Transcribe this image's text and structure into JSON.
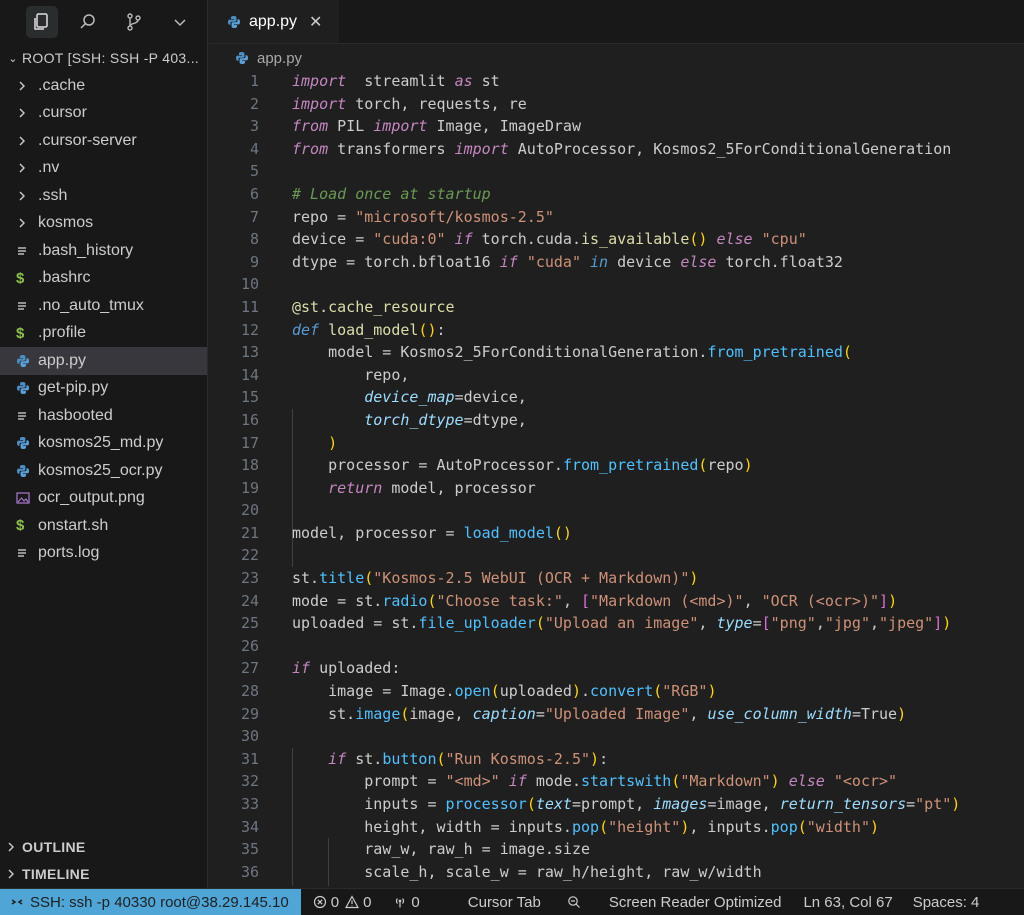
{
  "sidebar": {
    "root_label": "ROOT [SSH: SSH -P 403...",
    "items": [
      {
        "label": ".cache",
        "type": "folder"
      },
      {
        "label": ".cursor",
        "type": "folder"
      },
      {
        "label": ".cursor-server",
        "type": "folder"
      },
      {
        "label": ".nv",
        "type": "folder"
      },
      {
        "label": ".ssh",
        "type": "folder"
      },
      {
        "label": "kosmos",
        "type": "folder"
      },
      {
        "label": ".bash_history",
        "type": "text"
      },
      {
        "label": ".bashrc",
        "type": "shell"
      },
      {
        "label": ".no_auto_tmux",
        "type": "text"
      },
      {
        "label": ".profile",
        "type": "shell"
      },
      {
        "label": "app.py",
        "type": "python",
        "selected": true
      },
      {
        "label": "get-pip.py",
        "type": "python"
      },
      {
        "label": "hasbooted",
        "type": "text"
      },
      {
        "label": "kosmos25_md.py",
        "type": "python"
      },
      {
        "label": "kosmos25_ocr.py",
        "type": "python"
      },
      {
        "label": "ocr_output.png",
        "type": "image"
      },
      {
        "label": "onstart.sh",
        "type": "shell"
      },
      {
        "label": "ports.log",
        "type": "text"
      }
    ],
    "outline_label": "OUTLINE",
    "timeline_label": "TIMELINE"
  },
  "editor": {
    "tab_label": "app.py",
    "close_glyph": "✕",
    "breadcrumb": "app.py",
    "line_numbers": [
      "1",
      "2",
      "3",
      "4",
      "5",
      "6",
      "7",
      "8",
      "9",
      "10",
      "11",
      "12",
      "13",
      "14",
      "15",
      "16",
      "17",
      "18",
      "19",
      "20",
      "21",
      "22",
      "23",
      "24",
      "25",
      "26",
      "27",
      "28",
      "29",
      "30",
      "31",
      "32",
      "33",
      "34",
      "35",
      "36"
    ],
    "code": [
      [
        [
          "kw",
          "import"
        ],
        [
          "",
          "  streamlit "
        ],
        [
          "kw",
          "as"
        ],
        [
          "",
          " st"
        ]
      ],
      [
        [
          "kw",
          "import"
        ],
        [
          "",
          " torch, requests, re"
        ]
      ],
      [
        [
          "kw",
          "from"
        ],
        [
          "",
          " PIL "
        ],
        [
          "kw",
          "import"
        ],
        [
          "",
          " Image, ImageDraw"
        ]
      ],
      [
        [
          "kw",
          "from"
        ],
        [
          "",
          " transformers "
        ],
        [
          "kw",
          "import"
        ],
        [
          "",
          " AutoProcessor, Kosmos2_5ForConditionalGeneration"
        ]
      ],
      [],
      [
        [
          "cm",
          "# Load once at startup"
        ]
      ],
      [
        [
          "",
          "repo = "
        ],
        [
          "str",
          "\"microsoft/kosmos-2.5\""
        ]
      ],
      [
        [
          "",
          "device = "
        ],
        [
          "str",
          "\"cuda:0\""
        ],
        [
          "",
          " "
        ],
        [
          "kw",
          "if"
        ],
        [
          "",
          " torch.cuda."
        ],
        [
          "fn",
          "is_available"
        ],
        [
          "br",
          "()"
        ],
        [
          "",
          " "
        ],
        [
          "kw",
          "else"
        ],
        [
          "",
          " "
        ],
        [
          "str",
          "\"cpu\""
        ]
      ],
      [
        [
          "",
          "dtype = torch.bfloat16 "
        ],
        [
          "kw",
          "if"
        ],
        [
          "",
          " "
        ],
        [
          "str",
          "\"cuda\""
        ],
        [
          "",
          " "
        ],
        [
          "kw2",
          "in"
        ],
        [
          "",
          " device "
        ],
        [
          "kw",
          "else"
        ],
        [
          "",
          " torch.float32"
        ]
      ],
      [],
      [
        [
          "fn",
          "@st.cache_resource"
        ]
      ],
      [
        [
          "kw2",
          "def"
        ],
        [
          "",
          " "
        ],
        [
          "fn",
          "load_model"
        ],
        [
          "br",
          "()"
        ],
        [
          "",
          ":"
        ]
      ],
      [
        [
          "",
          "    model = Kosmos2_5ForConditionalGeneration."
        ],
        [
          "meth",
          "from_pretrained"
        ],
        [
          "br",
          "("
        ]
      ],
      [
        [
          "",
          "        repo,"
        ]
      ],
      [
        [
          "",
          "        "
        ],
        [
          "param",
          "device_map"
        ],
        [
          "",
          "=device,"
        ]
      ],
      [
        [
          "",
          "        "
        ],
        [
          "param",
          "torch_dtype"
        ],
        [
          "",
          "=dtype,"
        ]
      ],
      [
        [
          "",
          "    "
        ],
        [
          "br",
          ")"
        ]
      ],
      [
        [
          "",
          "    processor = AutoProcessor."
        ],
        [
          "meth",
          "from_pretrained"
        ],
        [
          "br",
          "("
        ],
        [
          "",
          "repo"
        ],
        [
          "br",
          ")"
        ]
      ],
      [
        [
          "",
          "    "
        ],
        [
          "kw",
          "return"
        ],
        [
          "",
          " model, processor"
        ]
      ],
      [],
      [
        [
          "",
          "model, processor = "
        ],
        [
          "meth",
          "load_model"
        ],
        [
          "br",
          "()"
        ]
      ],
      [],
      [
        [
          "",
          "st."
        ],
        [
          "meth",
          "title"
        ],
        [
          "br",
          "("
        ],
        [
          "str",
          "\"Kosmos-2.5 WebUI (OCR + Markdown)\""
        ],
        [
          "br",
          ")"
        ]
      ],
      [
        [
          "",
          "mode = st."
        ],
        [
          "meth",
          "radio"
        ],
        [
          "br",
          "("
        ],
        [
          "str",
          "\"Choose task:\""
        ],
        [
          "",
          ", "
        ],
        [
          "br2",
          "["
        ],
        [
          "str",
          "\"Markdown (<md>)\""
        ],
        [
          "",
          ", "
        ],
        [
          "str",
          "\"OCR (<ocr>)\""
        ],
        [
          "br2",
          "]"
        ],
        [
          "br",
          ")"
        ]
      ],
      [
        [
          "",
          "uploaded = st."
        ],
        [
          "meth",
          "file_uploader"
        ],
        [
          "br",
          "("
        ],
        [
          "str",
          "\"Upload an image\""
        ],
        [
          "",
          ", "
        ],
        [
          "param",
          "type"
        ],
        [
          "",
          "="
        ],
        [
          "br2",
          "["
        ],
        [
          "str",
          "\"png\""
        ],
        [
          "",
          ","
        ],
        [
          "str",
          "\"jpg\""
        ],
        [
          "",
          ","
        ],
        [
          "str",
          "\"jpeg\""
        ],
        [
          "br2",
          "]"
        ],
        [
          "br",
          ")"
        ]
      ],
      [],
      [
        [
          "kw",
          "if"
        ],
        [
          "",
          " uploaded:"
        ]
      ],
      [
        [
          "",
          "    image = Image."
        ],
        [
          "meth",
          "open"
        ],
        [
          "br",
          "("
        ],
        [
          "",
          "uploaded"
        ],
        [
          "br",
          ")"
        ],
        [
          "",
          "."
        ],
        [
          "meth",
          "convert"
        ],
        [
          "br",
          "("
        ],
        [
          "str",
          "\"RGB\""
        ],
        [
          "br",
          ")"
        ]
      ],
      [
        [
          "",
          "    st."
        ],
        [
          "meth",
          "image"
        ],
        [
          "br",
          "("
        ],
        [
          "",
          "image, "
        ],
        [
          "param",
          "caption"
        ],
        [
          "",
          "="
        ],
        [
          "str",
          "\"Uploaded Image\""
        ],
        [
          "",
          ", "
        ],
        [
          "param",
          "use_column_width"
        ],
        [
          "",
          "=True"
        ],
        [
          "br",
          ")"
        ]
      ],
      [],
      [
        [
          "",
          "    "
        ],
        [
          "kw",
          "if"
        ],
        [
          "",
          " st."
        ],
        [
          "meth",
          "button"
        ],
        [
          "br",
          "("
        ],
        [
          "str",
          "\"Run Kosmos-2.5\""
        ],
        [
          "br",
          ")"
        ],
        [
          "",
          ":"
        ]
      ],
      [
        [
          "",
          "        prompt = "
        ],
        [
          "str",
          "\"<md>\""
        ],
        [
          "",
          " "
        ],
        [
          "kw",
          "if"
        ],
        [
          "",
          " mode."
        ],
        [
          "meth",
          "startswith"
        ],
        [
          "br",
          "("
        ],
        [
          "str",
          "\"Markdown\""
        ],
        [
          "br",
          ")"
        ],
        [
          "",
          " "
        ],
        [
          "kw",
          "else"
        ],
        [
          "",
          " "
        ],
        [
          "str",
          "\"<ocr>\""
        ]
      ],
      [
        [
          "",
          "        inputs = "
        ],
        [
          "meth",
          "processor"
        ],
        [
          "br",
          "("
        ],
        [
          "param",
          "text"
        ],
        [
          "",
          "=prompt, "
        ],
        [
          "param",
          "images"
        ],
        [
          "",
          "=image, "
        ],
        [
          "param",
          "return_tensors"
        ],
        [
          "",
          "="
        ],
        [
          "str",
          "\"pt\""
        ],
        [
          "br",
          ")"
        ]
      ],
      [
        [
          "",
          "        height, width = inputs."
        ],
        [
          "meth",
          "pop"
        ],
        [
          "br",
          "("
        ],
        [
          "str",
          "\"height\""
        ],
        [
          "br",
          ")"
        ],
        [
          "",
          ", inputs."
        ],
        [
          "meth",
          "pop"
        ],
        [
          "br",
          "("
        ],
        [
          "str",
          "\"width\""
        ],
        [
          "br",
          ")"
        ]
      ],
      [
        [
          "",
          "        raw_w, raw_h = image.size"
        ]
      ],
      [
        [
          "",
          "        scale_h, scale_w = raw_h/height, raw_w/width"
        ]
      ]
    ]
  },
  "statusbar": {
    "remote": "SSH: ssh -p 40330 root@38.29.145.10",
    "errors": "0",
    "warnings": "0",
    "ports": "0",
    "cursor_tab": "Cursor Tab",
    "screen_reader": "Screen Reader Optimized",
    "position": "Ln 63, Col 67",
    "spaces": "Spaces: 4"
  }
}
